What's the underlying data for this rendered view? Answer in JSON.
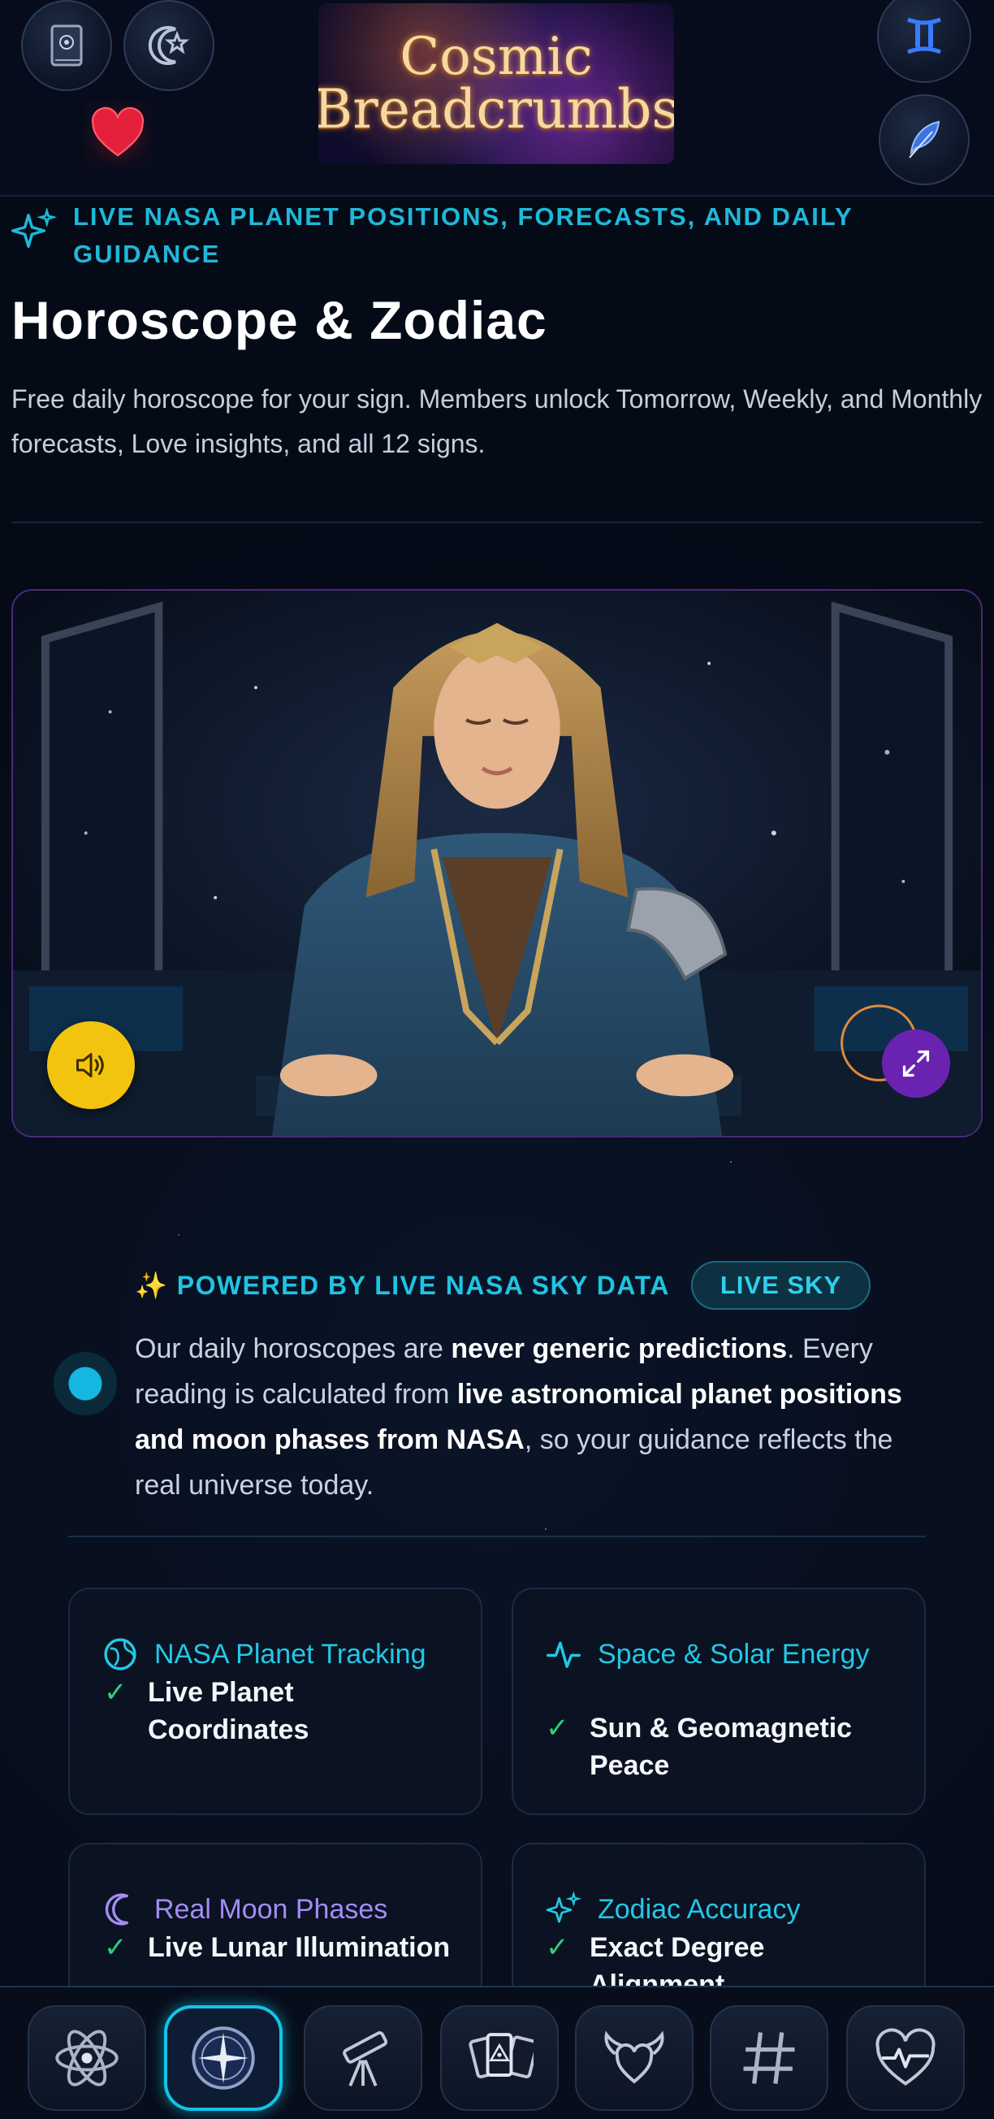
{
  "header": {
    "logo_line1": "Cosmic",
    "logo_line2": "Breadcrumbs",
    "icons": [
      "book-icon",
      "moon-star-icon",
      "heart-icon",
      "gemini-icon",
      "feather-icon"
    ]
  },
  "intro": {
    "eyebrow": "LIVE NASA PLANET POSITIONS, FORECASTS, AND DAILY GUIDANCE",
    "title": "Horoscope & Zodiac",
    "description": "Free daily horoscope for your sign. Members unlock Tomorrow, Weekly, and Monthly forecasts, Love insights, and all 12 signs."
  },
  "video": {
    "icons": [
      "speaker-icon",
      "expand-icon"
    ]
  },
  "nasa": {
    "heading": "✨ POWERED BY LIVE NASA SKY DATA",
    "badge": "LIVE SKY",
    "body_1": "Our daily horoscopes are ",
    "body_b1": "never generic predictions",
    "body_2": ". Every reading is calculated from ",
    "body_b2": "live astronomical planet positions and moon phases from NASA",
    "body_3": ", so your guidance reflects the real universe today."
  },
  "cards": [
    {
      "title": "NASA Planet Tracking",
      "value": "Live Planet Coordinates",
      "icon": "globe-icon",
      "color": "#22c8e6"
    },
    {
      "title": "Space & Solar Energy",
      "value": "Sun & Geomagnetic Peace",
      "icon": "pulse-icon",
      "color": "#22c8e6"
    },
    {
      "title": "Real Moon Phases",
      "value": "Live Lunar Illumination",
      "icon": "moon-icon",
      "color": "#a38cf5"
    },
    {
      "title": "Zodiac Accuracy",
      "value": "Exact Degree Alignment",
      "icon": "sparkle-icon",
      "color": "#22c8e6"
    }
  ],
  "bottom_nav": {
    "items": [
      "atom-icon",
      "compass-icon",
      "telescope-icon",
      "tarot-cards-icon",
      "winged-heart-icon",
      "hashtag-icon",
      "heartbeat-icon"
    ],
    "active_index": 1
  },
  "colors": {
    "accent": "#1fb8d8",
    "background": "#050a17",
    "check": "#2fcf75",
    "sound_button": "#f2c40f",
    "expand_button": "#6a22b0"
  }
}
